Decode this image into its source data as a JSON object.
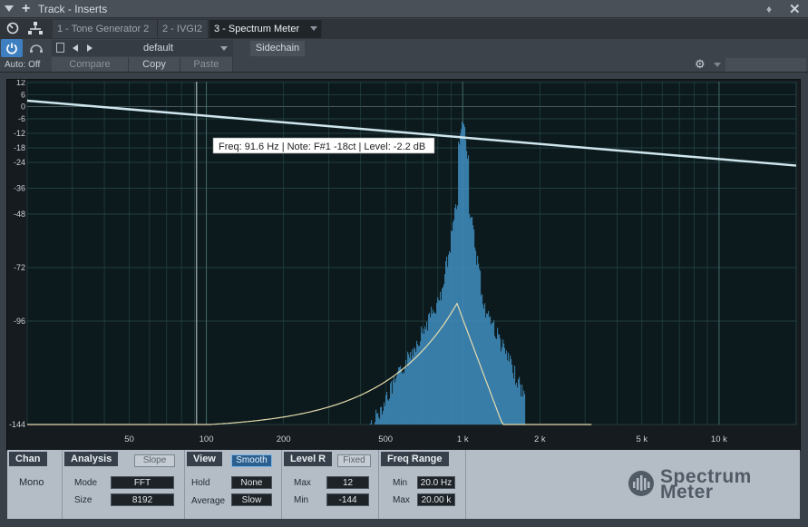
{
  "window": {
    "title": "Track - Inserts"
  },
  "tabs": [
    {
      "label": "1 - Tone Generator 2",
      "active": false
    },
    {
      "label": "2 - IVGI2",
      "active": false
    },
    {
      "label": "3 - Spectrum Meter",
      "active": true
    }
  ],
  "toolbar": {
    "auto_label": "Auto: Off",
    "preset_name": "default",
    "sidechain_label": "Sidechain",
    "compare_label": "Compare",
    "copy_label": "Copy",
    "paste_label": "Paste"
  },
  "spectrum": {
    "tooltip": "Freq: 91.6 Hz | Note: F#1 -18ct | Level: -2.2 dB",
    "cursor_freq_hz": 91.6,
    "level_ticks": [
      {
        "label": "12",
        "db": 12
      },
      {
        "label": "6",
        "db": 6
      },
      {
        "label": "0",
        "db": 0
      },
      {
        "label": "-6",
        "db": -6
      },
      {
        "label": "-12",
        "db": -12
      },
      {
        "label": "-18",
        "db": -18
      },
      {
        "label": "-24",
        "db": -24
      },
      {
        "label": "-36",
        "db": -36
      },
      {
        "label": "-48",
        "db": -48
      },
      {
        "label": "-72",
        "db": -72
      },
      {
        "label": "-96",
        "db": -96
      },
      {
        "label": "-144",
        "db": -144
      }
    ],
    "freq_ticks": [
      {
        "label": "50",
        "hz": 50
      },
      {
        "label": "100",
        "hz": 100
      },
      {
        "label": "200",
        "hz": 200
      },
      {
        "label": "500",
        "hz": 500
      },
      {
        "label": "1 k",
        "hz": 1000
      },
      {
        "label": "2 k",
        "hz": 2000
      },
      {
        "label": "5 k",
        "hz": 5000
      },
      {
        "label": "10 k",
        "hz": 10000
      }
    ],
    "colors": {
      "background": "#0c1a1d",
      "grid": "#2a4a4a",
      "bars": "#3e88b8",
      "slope_line": "#cfe6ee",
      "average_curve": "#e6dcae"
    }
  },
  "panel": {
    "chan": {
      "title": "Chan",
      "mode_value": "Mono"
    },
    "analysis": {
      "title": "Analysis",
      "slope_label": "Slope",
      "mode_label": "Mode",
      "mode_value": "FFT",
      "size_label": "Size",
      "size_value": "8192"
    },
    "view": {
      "title": "View",
      "smooth_label": "Smooth",
      "hold_label": "Hold",
      "hold_value": "None",
      "average_label": "Average",
      "average_value": "Slow"
    },
    "level": {
      "title": "Level R",
      "fixed_label": "Fixed",
      "max_label": "Max",
      "max_value": "12",
      "min_label": "Min",
      "min_value": "-144"
    },
    "freq_range": {
      "title": "Freq Range",
      "min_label": "Min",
      "min_value": "20.0 Hz",
      "max_label": "Max",
      "max_value": "20.00 k"
    },
    "logo": {
      "line1": "Spectrum",
      "line2": "Meter"
    }
  }
}
